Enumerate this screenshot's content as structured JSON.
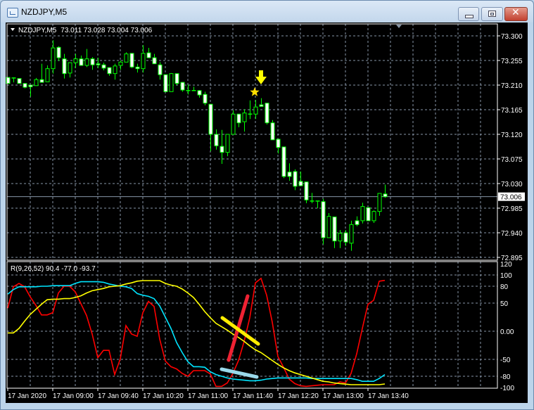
{
  "window": {
    "title": "NZDJPY,M5",
    "buttons": [
      "minimize",
      "maximize",
      "close"
    ]
  },
  "colors": {
    "bull_body": "#000000",
    "bear_body": "#ffffff",
    "candle_outline": "#00ff00",
    "grid": "#8796a8",
    "red_line": "#ff0000",
    "cyan_line": "#00e5ff",
    "yellow_line": "#ffff00",
    "annotation_red": "#ee2233",
    "annotation_yellow": "#ffee00",
    "annotation_blue": "#99d8ea",
    "arrow": "#ffff00",
    "star": "#ffdd00"
  },
  "chart_data": [
    {
      "type": "candlestick",
      "header": "NZDJPY,M5  73.011 73.028 73.004 73.006",
      "symbol": "NZDJPY,M5",
      "ohlc_label": "73.011 73.028 73.004 73.006",
      "ylim": [
        72.884,
        73.313
      ],
      "y_ticks": [
        "73.300",
        "73.255",
        "73.210",
        "73.165",
        "73.120",
        "73.075",
        "73.030",
        "72.985",
        "72.940",
        "72.895"
      ],
      "current_price": "73.006",
      "x_ticks": [
        "17 Jan 2020",
        "17 Jan 09:00",
        "17 Jan 09:40",
        "17 Jan 10:20",
        "17 Jan 11:00",
        "17 Jan 11:40",
        "17 Jan 12:20",
        "17 Jan 13:00",
        "17 Jan 13:40"
      ],
      "grid": true,
      "ohlc": [
        [
          73.224,
          73.224,
          73.213,
          73.213
        ],
        [
          73.223,
          73.224,
          73.215,
          73.222
        ],
        [
          73.222,
          73.222,
          73.213,
          73.213
        ],
        [
          73.213,
          73.213,
          73.204,
          73.206
        ],
        [
          73.21,
          73.21,
          73.189,
          73.207
        ],
        [
          73.209,
          73.223,
          73.209,
          73.22
        ],
        [
          73.22,
          73.249,
          73.215,
          73.215
        ],
        [
          73.216,
          73.246,
          73.216,
          73.24
        ],
        [
          73.24,
          73.292,
          73.231,
          73.278
        ],
        [
          73.279,
          73.281,
          73.254,
          73.26
        ],
        [
          73.258,
          73.267,
          73.222,
          73.231
        ],
        [
          73.232,
          73.251,
          73.224,
          73.251
        ],
        [
          73.251,
          73.267,
          73.241,
          73.258
        ],
        [
          73.258,
          73.264,
          73.246,
          73.246
        ],
        [
          73.246,
          73.276,
          73.243,
          73.258
        ],
        [
          73.258,
          73.261,
          73.238,
          73.247
        ],
        [
          73.249,
          73.26,
          73.241,
          73.247
        ],
        [
          73.247,
          73.251,
          73.237,
          73.241
        ],
        [
          73.242,
          73.242,
          73.227,
          73.231
        ],
        [
          73.231,
          73.249,
          73.22,
          73.245
        ],
        [
          73.246,
          73.255,
          73.238,
          73.252
        ],
        [
          73.252,
          73.27,
          73.252,
          73.267
        ],
        [
          73.268,
          73.268,
          73.241,
          73.243
        ],
        [
          73.243,
          73.249,
          73.233,
          73.24
        ],
        [
          73.24,
          73.283,
          73.233,
          73.268
        ],
        [
          73.269,
          73.278,
          73.26,
          73.26
        ],
        [
          73.26,
          73.267,
          73.249,
          73.249
        ],
        [
          73.247,
          73.252,
          73.22,
          73.229
        ],
        [
          73.229,
          73.229,
          73.197,
          73.198
        ],
        [
          73.198,
          73.232,
          73.198,
          73.231
        ],
        [
          73.231,
          73.231,
          73.21,
          73.213
        ],
        [
          73.215,
          73.215,
          73.198,
          73.201
        ],
        [
          73.2,
          73.211,
          73.193,
          73.2
        ],
        [
          73.2,
          73.207,
          73.2,
          73.2
        ],
        [
          73.2,
          73.201,
          73.187,
          73.192
        ],
        [
          73.193,
          73.198,
          73.173,
          73.177
        ],
        [
          73.175,
          73.175,
          73.089,
          73.12
        ],
        [
          73.12,
          73.129,
          73.092,
          73.099
        ],
        [
          73.098,
          73.128,
          73.066,
          73.087
        ],
        [
          73.087,
          73.12,
          73.08,
          73.12
        ],
        [
          73.12,
          73.164,
          73.12,
          73.157
        ],
        [
          73.157,
          73.157,
          73.133,
          73.141
        ],
        [
          73.143,
          73.166,
          73.125,
          73.159
        ],
        [
          73.157,
          73.182,
          73.148,
          73.157
        ],
        [
          73.157,
          73.183,
          73.148,
          73.17
        ],
        [
          73.174,
          73.186,
          73.171,
          73.171
        ],
        [
          73.177,
          73.177,
          73.138,
          73.141
        ],
        [
          73.141,
          73.146,
          73.11,
          73.11
        ],
        [
          73.111,
          73.112,
          73.085,
          73.096
        ],
        [
          73.097,
          73.097,
          73.04,
          73.043
        ],
        [
          73.051,
          73.067,
          73.035,
          73.043
        ],
        [
          73.052,
          73.056,
          73.018,
          73.025
        ],
        [
          73.034,
          73.052,
          73.026,
          73.026
        ],
        [
          73.033,
          73.033,
          72.994,
          73.0
        ],
        [
          72.998,
          73.013,
          72.994,
          72.998
        ],
        [
          72.998,
          72.998,
          72.985,
          72.998
        ],
        [
          72.997,
          73.002,
          72.919,
          72.931
        ],
        [
          72.931,
          72.976,
          72.931,
          72.97
        ],
        [
          72.969,
          72.969,
          72.912,
          72.925
        ],
        [
          72.925,
          72.945,
          72.912,
          72.939
        ],
        [
          72.94,
          72.945,
          72.916,
          72.923
        ],
        [
          72.921,
          72.962,
          72.907,
          72.955
        ],
        [
          72.962,
          72.97,
          72.952,
          72.955
        ],
        [
          72.962,
          72.995,
          72.957,
          72.988
        ],
        [
          72.986,
          72.986,
          72.962,
          72.962
        ],
        [
          72.962,
          72.981,
          72.958,
          72.979
        ],
        [
          72.979,
          73.012,
          72.971,
          73.012
        ],
        [
          73.011,
          73.028,
          73.004,
          73.006
        ]
      ]
    },
    {
      "type": "line",
      "header": "R(9,26,52) 90.4 -77.0 -93.7",
      "ylim": [
        -106,
        120
      ],
      "y_ticks": [
        "120",
        "100",
        "80",
        "50",
        "0.00",
        "-50",
        "-80",
        "-100"
      ],
      "grid": true,
      "series": [
        {
          "color": "#ff0000",
          "values": [
            41,
            79,
            85,
            79,
            61,
            46,
            29,
            29,
            33,
            68,
            80,
            80,
            70,
            49,
            28,
            -5,
            -47,
            -34,
            -34,
            -77,
            -49,
            10,
            -5,
            -9,
            33,
            53,
            44,
            -14,
            -53,
            -63,
            -67,
            -75,
            -80,
            -70,
            -70,
            -70,
            -76,
            -98,
            -98,
            -92,
            -75,
            -52,
            -18,
            24,
            86,
            94,
            64,
            16,
            -45,
            -64,
            -85,
            -93,
            -97,
            -98,
            -97,
            -96,
            -95,
            -95,
            -95,
            -90,
            -92,
            -75,
            -40,
            5,
            48,
            55,
            89,
            90.4
          ]
        },
        {
          "color": "#00e5ff",
          "values": [
            66,
            74,
            79,
            79,
            79,
            79,
            80,
            80,
            81,
            81,
            81,
            81,
            85,
            88,
            88,
            88,
            88,
            87,
            84,
            82,
            80,
            79,
            76,
            67,
            64,
            62,
            58,
            45,
            25,
            5,
            -20,
            -38,
            -54,
            -63,
            -63,
            -64,
            -72,
            -77,
            -80,
            -83,
            -85,
            -86,
            -87,
            -88,
            -88,
            -87,
            -85,
            -84,
            -83,
            -83,
            -83,
            -83,
            -83,
            -83,
            -84,
            -84,
            -84,
            -84,
            -84,
            -84,
            -84,
            -84,
            -86,
            -89,
            -89,
            -89,
            -84,
            -77.0
          ]
        },
        {
          "color": "#ffff00",
          "values": [
            -3,
            -3,
            5,
            18,
            30,
            39,
            48,
            56,
            57,
            57,
            58,
            58,
            60,
            63,
            68,
            72,
            74,
            76,
            79,
            80,
            81,
            84,
            86,
            89,
            90,
            90,
            90,
            90,
            85,
            82,
            80,
            75,
            68,
            60,
            48,
            35,
            24,
            14,
            8,
            2,
            -5,
            -11,
            -18,
            -26,
            -33,
            -38,
            -45,
            -52,
            -59,
            -65,
            -70,
            -74,
            -77,
            -80,
            -83,
            -86,
            -89,
            -90,
            -92,
            -93,
            -94,
            -95,
            -95,
            -95,
            -95,
            -95,
            -95,
            -93.7
          ]
        }
      ]
    }
  ]
}
